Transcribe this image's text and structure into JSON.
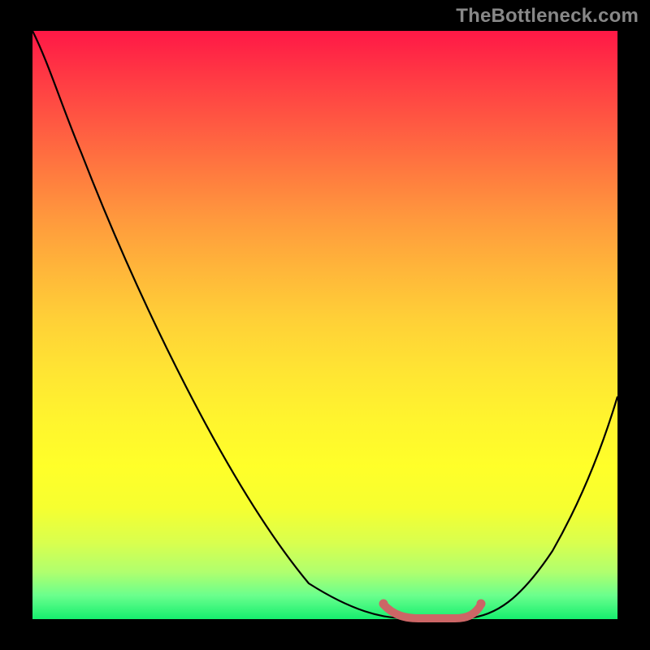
{
  "watermark": "TheBottleneck.com",
  "chart_data": {
    "type": "line",
    "title": "",
    "xlabel": "",
    "ylabel": "",
    "xlim": [
      0,
      100
    ],
    "ylim": [
      0,
      100
    ],
    "series": [
      {
        "name": "bottleneck-curve-left",
        "x": [
          0,
          5,
          10,
          15,
          20,
          25,
          30,
          35,
          40,
          45,
          50,
          55,
          60,
          63
        ],
        "y": [
          100,
          93,
          85,
          77,
          68,
          58,
          48,
          38,
          28,
          19,
          11,
          5,
          1,
          0
        ]
      },
      {
        "name": "bottleneck-curve-right",
        "x": [
          74,
          78,
          82,
          86,
          90,
          94,
          98,
          100
        ],
        "y": [
          0,
          2,
          5,
          10,
          17,
          25,
          33,
          38
        ]
      },
      {
        "name": "optimal-range",
        "x": [
          60,
          63,
          66,
          69,
          72,
          75,
          77
        ],
        "y": [
          2.5,
          0.5,
          0,
          0,
          0,
          0.5,
          2.5
        ]
      }
    ],
    "background_gradient": {
      "direction": "vertical",
      "stops": [
        {
          "pos": 0.0,
          "color": "#ff1846"
        },
        {
          "pos": 0.25,
          "color": "#ff7a3f"
        },
        {
          "pos": 0.5,
          "color": "#ffd037"
        },
        {
          "pos": 0.75,
          "color": "#ffff29"
        },
        {
          "pos": 1.0,
          "color": "#16ee6e"
        }
      ]
    },
    "highlight": {
      "color": "#cc6666",
      "x_range": [
        60,
        77
      ]
    },
    "grid": false,
    "legend": false
  }
}
